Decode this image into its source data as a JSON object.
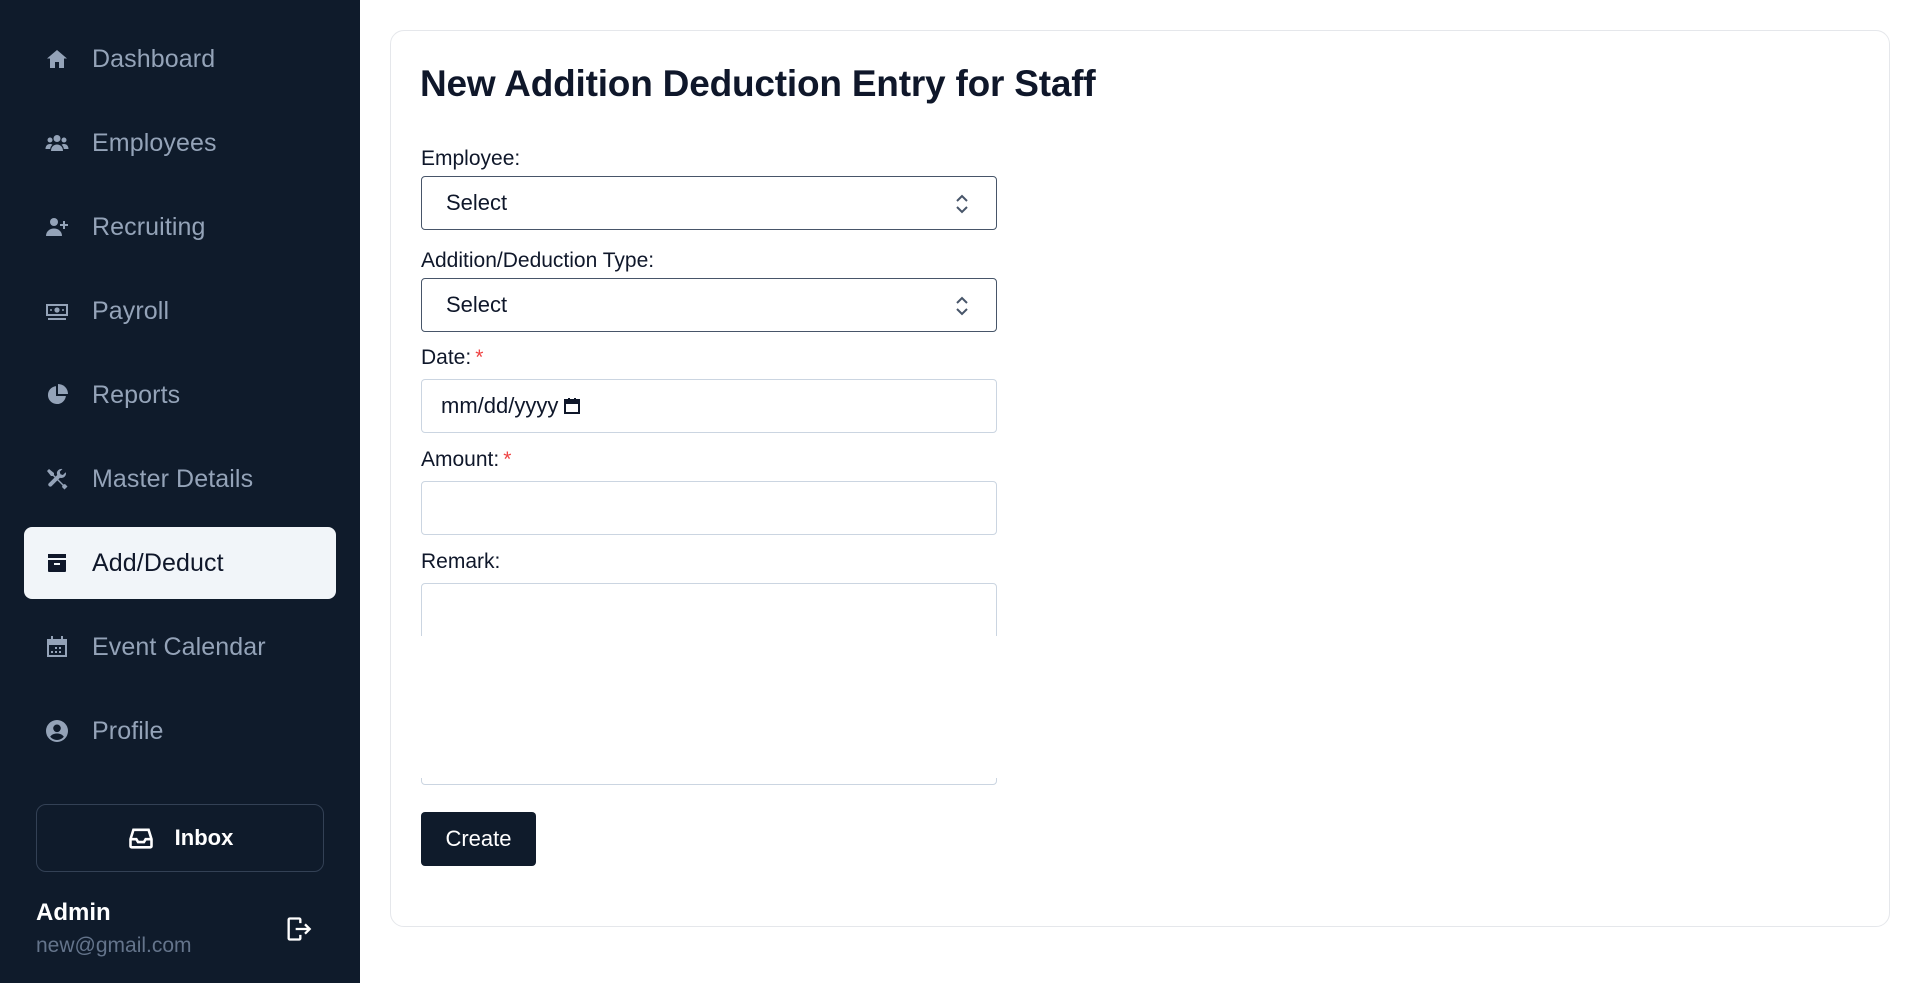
{
  "sidebar": {
    "items": [
      {
        "label": "Dashboard",
        "icon": "home-icon"
      },
      {
        "label": "Employees",
        "icon": "users-icon"
      },
      {
        "label": "Recruiting",
        "icon": "user-plus-icon"
      },
      {
        "label": "Payroll",
        "icon": "money-icon"
      },
      {
        "label": "Reports",
        "icon": "pie-chart-icon"
      },
      {
        "label": "Master Details",
        "icon": "tools-icon"
      },
      {
        "label": "Add/Deduct",
        "icon": "archive-icon",
        "active": true
      },
      {
        "label": "Event Calendar",
        "icon": "calendar-icon"
      },
      {
        "label": "Profile",
        "icon": "user-circle-icon"
      }
    ],
    "inbox_label": "Inbox",
    "user": {
      "name": "Admin",
      "email": "new@gmail.com"
    }
  },
  "form": {
    "title": "New Addition Deduction Entry for Staff",
    "employee": {
      "label": "Employee:",
      "value": "Select"
    },
    "type": {
      "label": "Addition/Deduction Type:",
      "value": "Select"
    },
    "date": {
      "label": "Date:",
      "required_mark": "*",
      "placeholder": "mm/dd/yyyy"
    },
    "amount": {
      "label": "Amount:",
      "required_mark": "*",
      "value": ""
    },
    "remark": {
      "label": "Remark:",
      "value": ""
    },
    "submit_label": "Create"
  },
  "colors": {
    "sidebar_bg": "#0f1b2b",
    "active_item_bg": "#f1f5f9",
    "nav_text": "#94a3b8",
    "required": "#ef4444",
    "button_bg": "#0f1b2b"
  }
}
